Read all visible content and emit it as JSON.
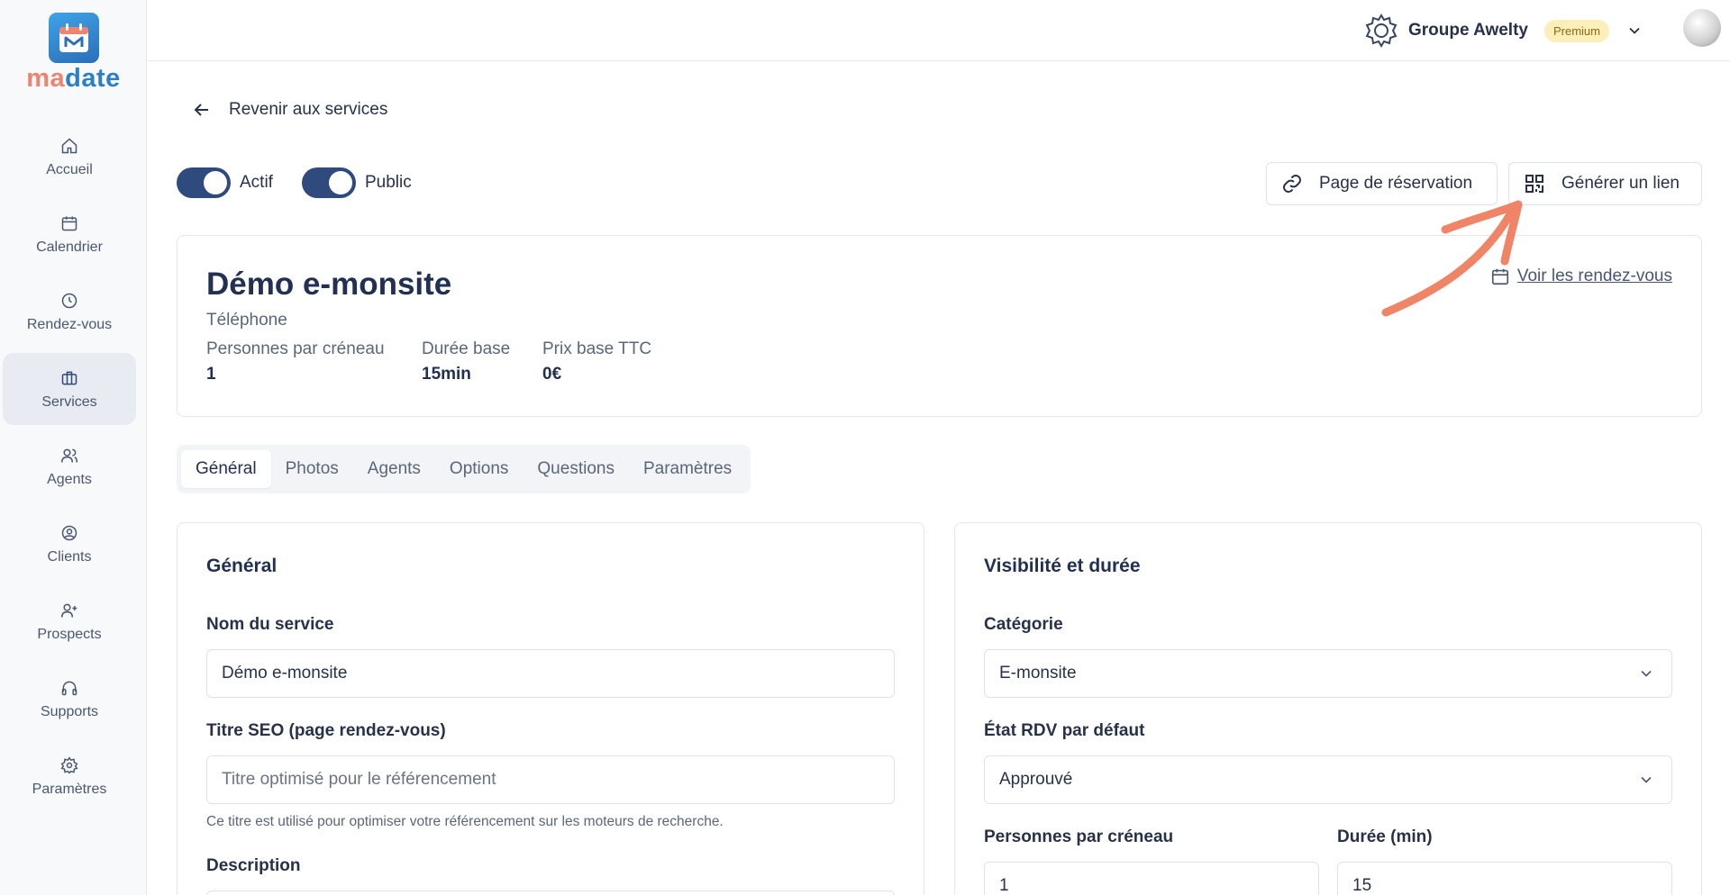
{
  "app": {
    "logo_ma": "ma",
    "logo_date": "date",
    "brand_colors": {
      "ma": "#f0836d",
      "date": "#2b7fc4"
    }
  },
  "sidebar": {
    "items": [
      {
        "label": "Accueil",
        "icon": "home-icon"
      },
      {
        "label": "Calendrier",
        "icon": "calendar-icon"
      },
      {
        "label": "Rendez-vous",
        "icon": "clock-icon"
      },
      {
        "label": "Services",
        "icon": "briefcase-icon",
        "active": true
      },
      {
        "label": "Agents",
        "icon": "users-icon"
      },
      {
        "label": "Clients",
        "icon": "user-circle-icon"
      },
      {
        "label": "Prospects",
        "icon": "user-plus-icon"
      },
      {
        "label": "Supports",
        "icon": "headphones-icon"
      },
      {
        "label": "Paramètres",
        "icon": "gear-icon"
      }
    ]
  },
  "topbar": {
    "org_name": "Groupe Awelty",
    "plan_badge": "Premium"
  },
  "page": {
    "back_label": "Revenir aux services",
    "toggles": {
      "active_label": "Actif",
      "public_label": "Public",
      "active_on": true,
      "public_on": true
    },
    "booking_page_button": "Page de réservation",
    "generate_link_button": "Générer un lien"
  },
  "service": {
    "title": "Démo e-monsite",
    "type": "Téléphone",
    "see_appointments": "Voir les rendez-vous",
    "stats": [
      {
        "key": "Personnes par créneau",
        "value": "1"
      },
      {
        "key": "Durée base",
        "value": "15min"
      },
      {
        "key": "Prix base TTC",
        "value": "0€"
      }
    ]
  },
  "tabs": [
    "Général",
    "Photos",
    "Agents",
    "Options",
    "Questions",
    "Paramètres"
  ],
  "general": {
    "heading": "Général",
    "name_label": "Nom du service",
    "name_value": "Démo e-monsite",
    "seo_label": "Titre SEO (page rendez-vous)",
    "seo_placeholder": "Titre optimisé pour le référencement",
    "seo_help": "Ce titre est utilisé pour optimiser votre référencement sur les moteurs de recherche.",
    "description_label": "Description"
  },
  "visibility": {
    "heading": "Visibilité et durée",
    "category_label": "Catégorie",
    "category_value": "E-monsite",
    "state_label": "État RDV par défaut",
    "state_value": "Approuvé",
    "persons_label": "Personnes par créneau",
    "persons_value": "1",
    "duration_label": "Durée (min)",
    "duration_value": "15"
  }
}
